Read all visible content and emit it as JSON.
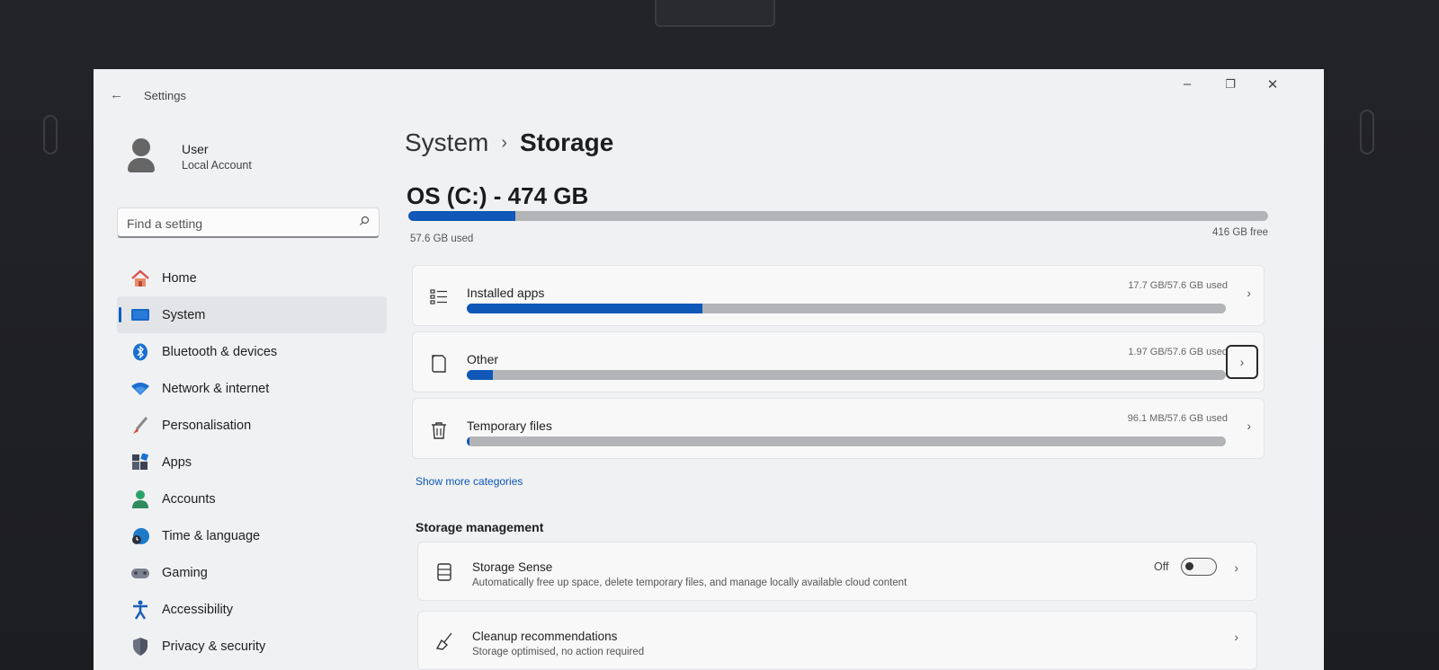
{
  "window": {
    "title": "Settings",
    "back_glyph": "←",
    "minimize_glyph": "–",
    "restore_glyph": "❐",
    "close_glyph": "✕"
  },
  "user": {
    "name": "User",
    "account_type": "Local Account"
  },
  "search": {
    "placeholder": "Find a setting"
  },
  "sidebar": {
    "items": [
      {
        "label": "Home",
        "icon": "home-icon"
      },
      {
        "label": "System",
        "icon": "monitor-icon",
        "active": true
      },
      {
        "label": "Bluetooth & devices",
        "icon": "bluetooth-icon"
      },
      {
        "label": "Network & internet",
        "icon": "wifi-icon"
      },
      {
        "label": "Personalisation",
        "icon": "brush-icon"
      },
      {
        "label": "Apps",
        "icon": "apps-icon"
      },
      {
        "label": "Accounts",
        "icon": "person-icon"
      },
      {
        "label": "Time & language",
        "icon": "globe-clock-icon"
      },
      {
        "label": "Gaming",
        "icon": "gamepad-icon"
      },
      {
        "label": "Accessibility",
        "icon": "accessibility-icon"
      },
      {
        "label": "Privacy & security",
        "icon": "shield-icon"
      }
    ]
  },
  "breadcrumb": {
    "parent": "System",
    "separator": "›",
    "current": "Storage"
  },
  "drive": {
    "title": "OS (C:) - 474 GB",
    "used_label": "57.6 GB used",
    "free_label": "416 GB free",
    "used_fraction": 0.124
  },
  "categories": [
    {
      "name": "Installed apps",
      "usage": "17.7 GB/57.6 GB used",
      "fraction": 0.31,
      "icon": "list-icon"
    },
    {
      "name": "Other",
      "usage": "1.97 GB/57.6 GB used",
      "fraction": 0.034,
      "icon": "document-icon"
    },
    {
      "name": "Temporary files",
      "usage": "96.1 MB/57.6 GB used",
      "fraction": 0.002,
      "icon": "trash-icon"
    }
  ],
  "show_more": "Show more categories",
  "storage_management": {
    "heading": "Storage management",
    "storage_sense": {
      "title": "Storage Sense",
      "description": "Automatically free up space, delete temporary files, and manage locally available cloud content",
      "state": "Off",
      "enabled": false
    },
    "cleanup": {
      "title": "Cleanup recommendations",
      "description": "Storage optimised, no action required"
    }
  },
  "colors": {
    "accent": "#0f58b8",
    "bar_track": "#b3b4b7",
    "link": "#0b57b5"
  }
}
